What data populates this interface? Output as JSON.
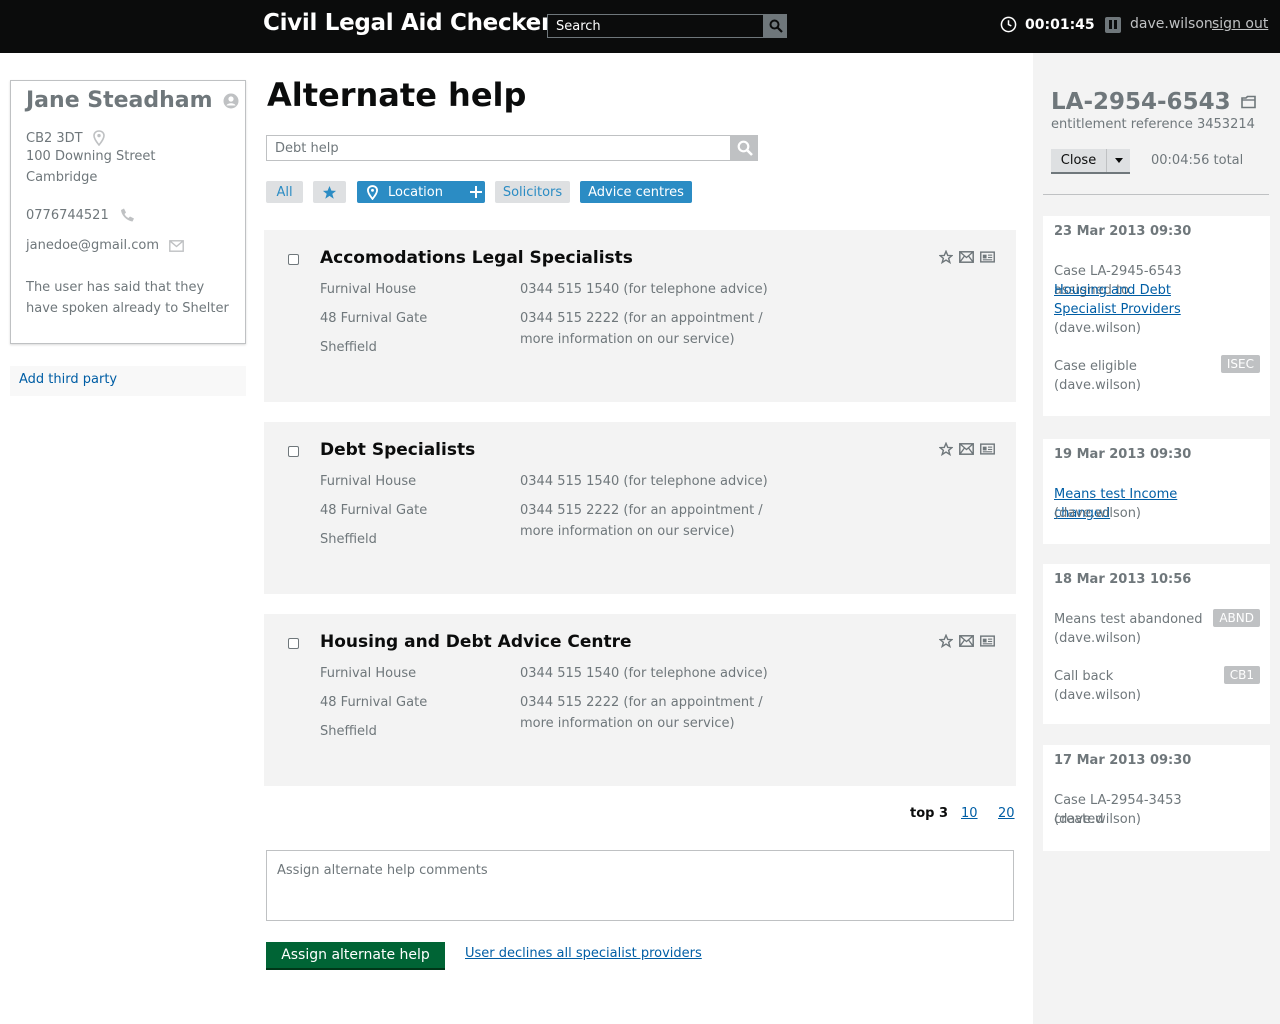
{
  "header": {
    "app_title": "Civil Legal Aid Checker",
    "search_placeholder": "Search",
    "timer": "00:01:45",
    "user": "dave.wilson",
    "sign_out": "sign out"
  },
  "person": {
    "name": "Jane Steadham",
    "postcode": "CB2 3DT",
    "street": "100 Downing Street",
    "city": "Cambridge",
    "phone": "0776744521",
    "email": "janedoe@gmail.com",
    "note": "The user has said that they have spoken already to Shelter"
  },
  "sidebar": {
    "add_third_party": "Add third party"
  },
  "main": {
    "title": "Alternate help",
    "filter_value": "Debt help",
    "chips": {
      "all": "All",
      "location": "Location",
      "solicitors": "Solicitors",
      "advice_centres": "Advice centres"
    },
    "results": [
      {
        "name": "Accomodations Legal Specialists",
        "address": [
          "Furnival House",
          "48 Furnival Gate",
          "Sheffield"
        ],
        "tel1": "0344 515 1540 (for telephone advice)",
        "tel2": "0344 515 2222 (for an appointment / more information on our service)"
      },
      {
        "name": "Debt Specialists",
        "address": [
          "Furnival House",
          "48 Furnival Gate",
          "Sheffield"
        ],
        "tel1": "0344 515 1540 (for telephone advice)",
        "tel2": "0344 515 2222 (for an appointment / more information on our service)"
      },
      {
        "name": "Housing and Debt Advice Centre",
        "address": [
          "Furnival House",
          "48 Furnival Gate",
          "Sheffield"
        ],
        "tel1": "0344 515 1540 (for telephone advice)",
        "tel2": "0344 515 2222 (for an appointment / more information on our service)"
      }
    ],
    "pager": {
      "current": "top 3",
      "opt1": "10",
      "opt2": "20"
    },
    "comments_placeholder": "Assign alternate help comments",
    "assign_button": "Assign  alternate help",
    "decline_link": "User declines all specialist providers"
  },
  "case": {
    "reference": "LA-2954-6543",
    "entitlement": "entitlement reference 3453214",
    "close_button": "Close",
    "total": "00:04:56 total",
    "events": [
      {
        "date": "23 Mar 2013 09:30",
        "assigned_text": "Case LA-2945-6543 assigned to",
        "assigned_link": "Housing and Debt Specialist Providers",
        "assigned_by": "(dave.wilson)",
        "eligible_text": "Case eligible",
        "eligible_by": "(dave.wilson)",
        "eligible_badge": "ISEC"
      },
      {
        "date": "19 Mar 2013 09:30",
        "link": "Means test Income changed",
        "by": "(dave.wilson)"
      },
      {
        "date": "18 Mar 2013 10:56",
        "abandoned_text": "Means test abandoned",
        "abandoned_by": "(dave.wilson)",
        "abandoned_badge": "ABND",
        "callback_text": "Call back",
        "callback_by": "(dave.wilson)",
        "callback_badge": "CB1"
      },
      {
        "date": "17 Mar 2013 09:30",
        "created_text": "Case LA-2954-3453 created",
        "created_by": "(dave.wilson)"
      }
    ]
  },
  "colors": {
    "header_bg": "#0b0c0c",
    "link": "#005ea5",
    "chip_active": "#2b8cc4",
    "assign_green": "#006435"
  }
}
